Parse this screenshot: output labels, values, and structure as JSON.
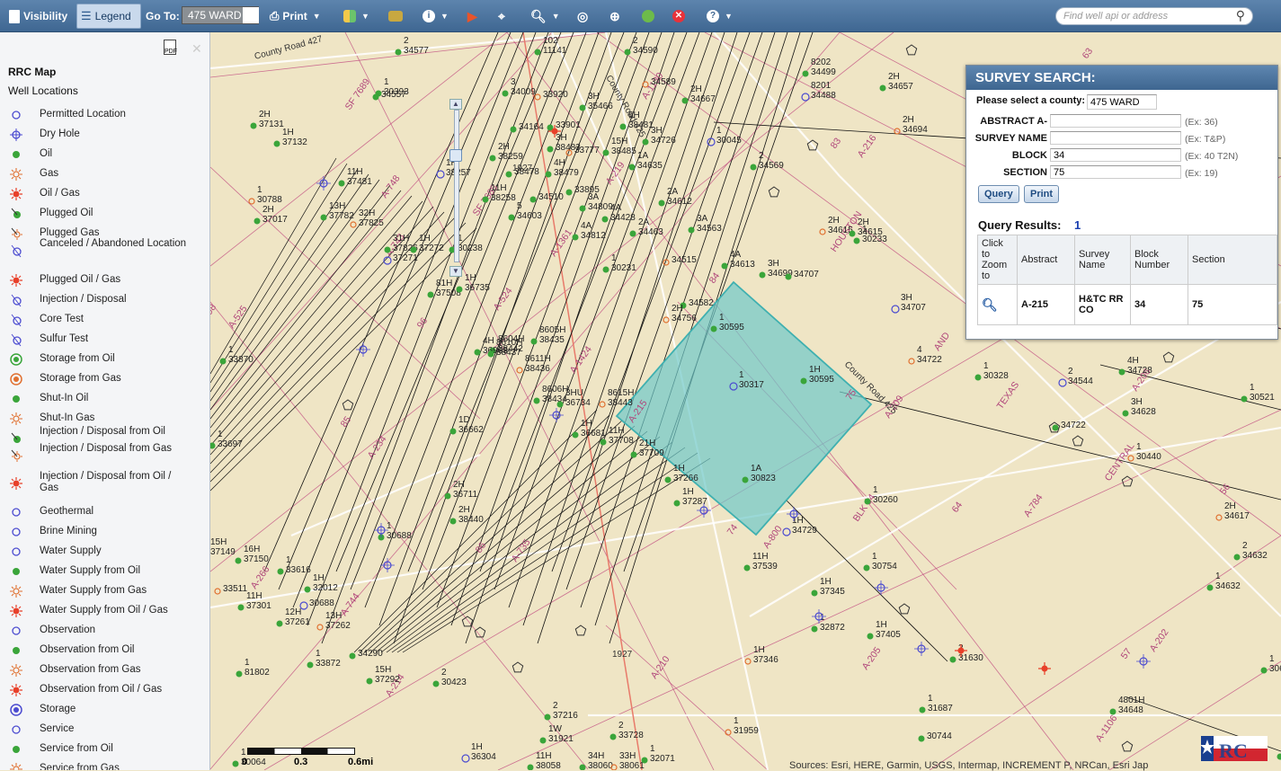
{
  "toolbar": {
    "visibility_label": "Visibility",
    "legend_label": "Legend",
    "goto_label": "Go To:",
    "goto_value": "475 WARD",
    "print_label": "Print",
    "search_placeholder": "Find well api or address"
  },
  "sidebar": {
    "title": "RRC Map",
    "subtitle": "Well Locations",
    "items": [
      {
        "label": "Permitted Location"
      },
      {
        "label": "Dry Hole"
      },
      {
        "label": "Oil"
      },
      {
        "label": "Gas"
      },
      {
        "label": "Oil / Gas"
      },
      {
        "label": "Plugged Oil"
      },
      {
        "label": "Plugged Gas"
      },
      {
        "label": "Canceled / Abandoned Location"
      },
      {
        "label": "Plugged Oil / Gas"
      },
      {
        "label": "Injection / Disposal"
      },
      {
        "label": "Core Test"
      },
      {
        "label": "Sulfur Test"
      },
      {
        "label": "Storage from Oil"
      },
      {
        "label": "Storage from Gas"
      },
      {
        "label": "Shut-In Oil"
      },
      {
        "label": "Shut-In Gas"
      },
      {
        "label": "Injection / Disposal from Oil"
      },
      {
        "label": "Injection / Disposal from Gas"
      },
      {
        "label": "Injection / Disposal from Oil / Gas"
      },
      {
        "label": "Geothermal"
      },
      {
        "label": "Brine Mining"
      },
      {
        "label": "Water Supply"
      },
      {
        "label": "Water Supply from Oil"
      },
      {
        "label": "Water Supply from Gas"
      },
      {
        "label": "Water Supply from Oil / Gas"
      },
      {
        "label": "Observation"
      },
      {
        "label": "Observation from Oil"
      },
      {
        "label": "Observation from Gas"
      },
      {
        "label": "Observation from Oil / Gas"
      },
      {
        "label": "Storage"
      },
      {
        "label": "Service"
      },
      {
        "label": "Service from Oil"
      },
      {
        "label": "Service from Gas"
      }
    ]
  },
  "survey": {
    "title": "SURVEY SEARCH:",
    "county_label": "Please select a county:",
    "county_value": "475 WARD",
    "abstract_label": "ABSTRACT A-",
    "abstract_value": "",
    "abstract_ex": "(Ex: 36)",
    "survey_name_label": "SURVEY NAME",
    "survey_name_value": "",
    "survey_name_ex": "(Ex: T&P)",
    "block_label": "BLOCK",
    "block_value": "34",
    "block_ex": "(Ex: 40 T2N)",
    "section_label": "SECTION",
    "section_value": "75",
    "section_ex": "(Ex: 19)",
    "query_button": "Query",
    "print_button": "Print",
    "results_label": "Query Results:",
    "results_count": "1",
    "columns": [
      "Click to Zoom to",
      "Abstract",
      "Survey Name",
      "Block Number",
      "Section"
    ],
    "rows": [
      {
        "abstract": "A-215",
        "survey_name": "H&TC RR CO",
        "block": "34",
        "section": "75"
      }
    ]
  },
  "map": {
    "scale_labels": [
      "0",
      "0.3",
      "0.6mi"
    ],
    "attribution": "Sources: Esri, HERE, Garmin, USGS, Intermap, INCREMENT P, NRCan, Esri Jap",
    "road_labels": [
      "County Road 427",
      "County Road 425",
      "County Road 425",
      "1927",
      "1927"
    ],
    "survey_labels": [
      "SF 7689",
      "A-748",
      "SF 7688",
      "A-1361",
      "A-1130",
      "A-219",
      "A-216",
      "A-524",
      "A-1424",
      "A-215",
      "A-209",
      "A-784",
      "A-800",
      "A-210",
      "A-205",
      "A-1106",
      "A-202",
      "A-206",
      "A-525",
      "A-214",
      "A-234",
      "A-266",
      "A-735",
      "A-743",
      "A-744",
      "HOUSTON",
      "AND",
      "TEXAS",
      "CENTRAL",
      "BLK 34",
      "83",
      "84",
      "63",
      "64",
      "98",
      "85",
      "86",
      "74",
      "75",
      "56",
      "57",
      "96"
    ],
    "well_labels": [
      {
        "t": "2\n34577"
      },
      {
        "t": "102\n11141"
      },
      {
        "t": "2\n34590"
      },
      {
        "t": "34589"
      },
      {
        "t": "8202\n34499"
      },
      {
        "t": "8201\n34488"
      },
      {
        "t": "2H\n34657"
      },
      {
        "t": "1\n30393"
      },
      {
        "t": "34557"
      },
      {
        "t": "3\n34009"
      },
      {
        "t": "33920"
      },
      {
        "t": "2H\n34667"
      },
      {
        "t": "2H\n37131"
      },
      {
        "t": "1H\n37132"
      },
      {
        "t": "3H\n35466"
      },
      {
        "t": "6H\n38481"
      },
      {
        "t": "1\n30045"
      },
      {
        "t": "2H\n34694"
      },
      {
        "t": "3H\n34726"
      },
      {
        "t": "1A\n34635"
      },
      {
        "t": "2\n34569"
      },
      {
        "t": "34164"
      },
      {
        "t": "33901"
      },
      {
        "t": "3H\n38483"
      },
      {
        "t": "33777"
      },
      {
        "t": "15H\n38485"
      },
      {
        "t": "2H\n38259"
      },
      {
        "t": "1H\n38257"
      },
      {
        "t": "38478"
      },
      {
        "t": "4H\n38479"
      },
      {
        "t": "11H\n37481"
      },
      {
        "t": "1\n30788"
      },
      {
        "t": "13H\n37782"
      },
      {
        "t": "2H\n37017"
      },
      {
        "t": "11H\n38258"
      },
      {
        "t": "34510"
      },
      {
        "t": "33895"
      },
      {
        "t": "2A\n34612"
      },
      {
        "t": "32H\n37825"
      },
      {
        "t": "5\n34603"
      },
      {
        "t": "3A\n34809"
      },
      {
        "t": "4A\n34428"
      },
      {
        "t": "4A\n34812"
      },
      {
        "t": "2A\n34463"
      },
      {
        "t": "3A\n34563"
      },
      {
        "t": "2H\n34615"
      },
      {
        "t": "1\n30233"
      },
      {
        "t": "31H\n37826"
      },
      {
        "t": "1H\n37272"
      },
      {
        "t": "37271"
      },
      {
        "t": "1\n30238"
      },
      {
        "t": "1\n30231"
      },
      {
        "t": "34515"
      },
      {
        "t": "4A\n34613"
      },
      {
        "t": "3H\n34699"
      },
      {
        "t": "34707"
      },
      {
        "t": "81H\n37508"
      },
      {
        "t": "1H\n36735"
      },
      {
        "t": "34582"
      },
      {
        "t": "2H\n34756"
      },
      {
        "t": "3H\n34707"
      },
      {
        "t": "1\n30595"
      },
      {
        "t": "8605H\n38435"
      },
      {
        "t": "8604H\n38442"
      },
      {
        "t": "4H\n36963"
      },
      {
        "t": "8610H\n38437"
      },
      {
        "t": "8611H\n38436"
      },
      {
        "t": "8606H\n38434"
      },
      {
        "t": "3HU\n36734"
      },
      {
        "t": "1H\n36681"
      },
      {
        "t": "1\n33870"
      },
      {
        "t": "1\n30317"
      },
      {
        "t": "1H\n30595"
      },
      {
        "t": "8615H\n38443"
      },
      {
        "t": "11H\n37708"
      },
      {
        "t": "1D\n36662"
      },
      {
        "t": "1\n33697"
      },
      {
        "t": "21H\n37709"
      },
      {
        "t": "1H\n37266"
      },
      {
        "t": "1A\n30823"
      },
      {
        "t": "4\n34722"
      },
      {
        "t": "1\n30328"
      },
      {
        "t": "2\n34544"
      },
      {
        "t": "4H\n34728"
      },
      {
        "t": "1\n30521"
      },
      {
        "t": "3H\n34628"
      },
      {
        "t": "34722"
      },
      {
        "t": "1\n30440"
      },
      {
        "t": "2H\n36711"
      },
      {
        "t": "1H\n37287"
      },
      {
        "t": "1\n30260"
      },
      {
        "t": "2H\n38440"
      },
      {
        "t": "1\n30688"
      },
      {
        "t": "1H\n34729"
      },
      {
        "t": "2H\n34617"
      },
      {
        "t": "15H\n37149"
      },
      {
        "t": "16H\n37150"
      },
      {
        "t": "1\n33616"
      },
      {
        "t": "11H\n37539"
      },
      {
        "t": "1\n30754"
      },
      {
        "t": "2\n34632"
      },
      {
        "t": "33511"
      },
      {
        "t": "11H\n37301"
      },
      {
        "t": "1H\n32012"
      },
      {
        "t": "30688"
      },
      {
        "t": "1H\n37345"
      },
      {
        "t": "1\n32872"
      },
      {
        "t": "12H\n37261"
      },
      {
        "t": "13H\n37262"
      },
      {
        "t": "1H\n37405"
      },
      {
        "t": "1\n34632"
      },
      {
        "t": "1\n81802"
      },
      {
        "t": "1\n33872"
      },
      {
        "t": "15H\n37292"
      },
      {
        "t": "2\n30423"
      },
      {
        "t": "1H\n37346"
      },
      {
        "t": "2\n31630"
      },
      {
        "t": "1\n30695"
      },
      {
        "t": "4801H\n34648"
      },
      {
        "t": "2\n37216"
      },
      {
        "t": "2\n33728"
      },
      {
        "t": "1W\n31921"
      },
      {
        "t": "1\n31959"
      },
      {
        "t": "1\n31687"
      },
      {
        "t": "30744"
      },
      {
        "t": "1\n30743"
      },
      {
        "t": "1H\n36304"
      },
      {
        "t": "11H\n38058"
      },
      {
        "t": "34H\n38060"
      },
      {
        "t": "33H\n38061"
      },
      {
        "t": "1\n32071"
      },
      {
        "t": "1\n30064"
      },
      {
        "t": "34290"
      },
      {
        "t": "2H\n34615"
      }
    ]
  },
  "colors": {
    "toolbar": "#4a72a0",
    "oil_well": "#3aa53a",
    "gas_symbol": "#e07030",
    "permitted": "#4b4bd0",
    "survey_highlight": "#6fc9c9",
    "survey_line": "#c0487f",
    "road": "#ffffff"
  },
  "icons": {
    "visibility": "document-icon",
    "legend": "list-icon",
    "print": "printer-icon",
    "search": "search-icon"
  }
}
